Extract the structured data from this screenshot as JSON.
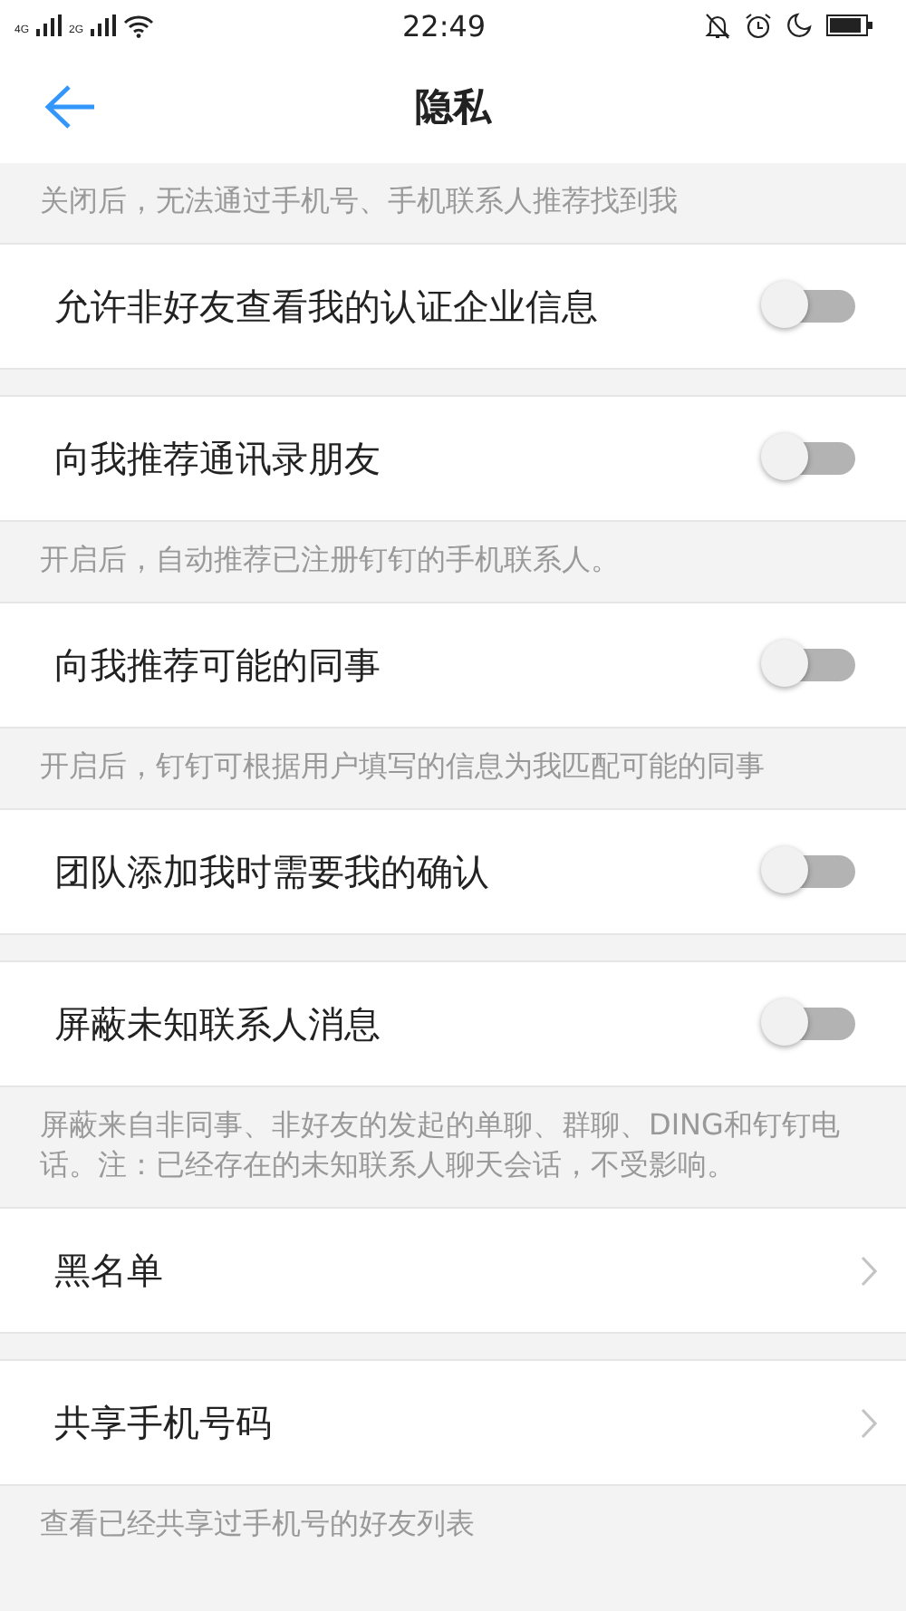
{
  "status_bar": {
    "networks": [
      "4G",
      "2G"
    ],
    "time": "22:49"
  },
  "header": {
    "title": "隐私"
  },
  "items": [
    {
      "kind": "note",
      "text": "关闭后，无法通过手机号、手机联系人推荐找到我"
    },
    {
      "kind": "toggle",
      "label": "允许非好友查看我的认证企业信息",
      "on": false
    },
    {
      "kind": "toggle",
      "label": "向我推荐通讯录朋友",
      "on": false
    },
    {
      "kind": "note",
      "text": "开启后，自动推荐已注册钉钉的手机联系人。"
    },
    {
      "kind": "toggle",
      "label": "向我推荐可能的同事",
      "on": false
    },
    {
      "kind": "note",
      "text": "开启后，钉钉可根据用户填写的信息为我匹配可能的同事"
    },
    {
      "kind": "toggle",
      "label": "团队添加我时需要我的确认",
      "on": false
    },
    {
      "kind": "toggle",
      "label": "屏蔽未知联系人消息",
      "on": false
    },
    {
      "kind": "note",
      "text": "屏蔽来自非同事、非好友的发起的单聊、群聊、DING和钉钉电话。注：已经存在的未知联系人聊天会话，不受影响。"
    },
    {
      "kind": "link",
      "label": "黑名单"
    },
    {
      "kind": "link",
      "label": "共享手机号码"
    },
    {
      "kind": "note",
      "text": "查看已经共享过手机号的好友列表"
    }
  ]
}
